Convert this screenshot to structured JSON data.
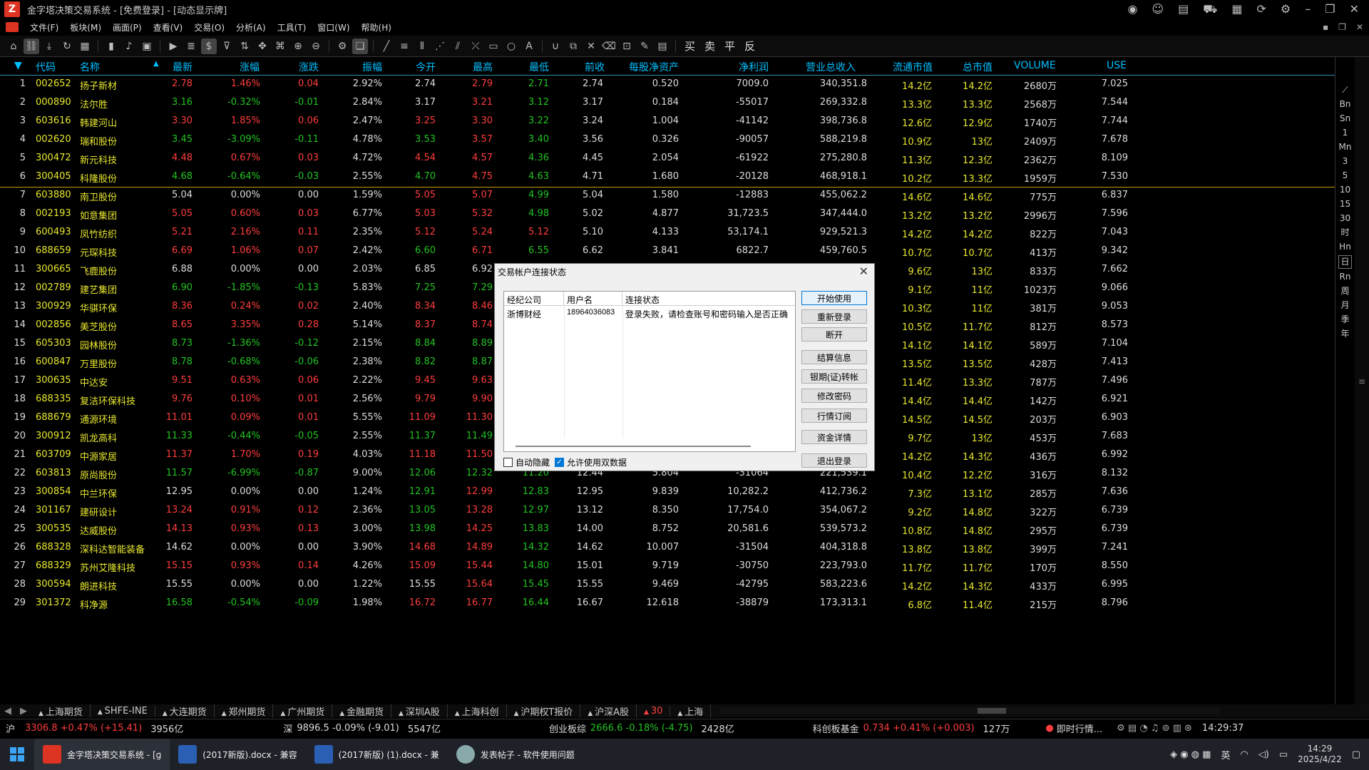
{
  "window": {
    "title": "金字塔决策交易系统 - [免费登录] - [动态显示牌]"
  },
  "menu": {
    "items": [
      "文件(F)",
      "板块(M)",
      "画面(P)",
      "查看(V)",
      "交易(O)",
      "分析(A)",
      "工具(T)",
      "窗口(W)",
      "帮助(H)"
    ]
  },
  "toolbar": {
    "trade_labels": [
      "买",
      "卖",
      "平",
      "反"
    ]
  },
  "table": {
    "headers": [
      "代码",
      "名称",
      "最新",
      "涨幅",
      "涨跌",
      "振幅",
      "今开",
      "最高",
      "最低",
      "前收",
      "每股净资产",
      "净利润",
      "营业总收入",
      "流通市值",
      "总市值",
      "VOLUME",
      "USE"
    ],
    "rows": [
      {
        "no": "1",
        "code": "002652",
        "name": "扬子新材",
        "last": "2.78",
        "pct": "1.46%",
        "chg": "0.04",
        "amp": "2.92%",
        "open": "2.74",
        "high": "2.79",
        "low": "2.71",
        "prev": "2.74",
        "nav": "0.520",
        "np": "7009.0",
        "rev": "340,351.8",
        "fmv": "14.2亿",
        "tmv": "14.2亿",
        "vol": "2680万",
        "use": "7.025"
      },
      {
        "no": "2",
        "code": "000890",
        "name": "法尔胜",
        "last": "3.16",
        "pct": "-0.32%",
        "chg": "-0.01",
        "amp": "2.84%",
        "open": "3.17",
        "high": "3.21",
        "low": "3.12",
        "prev": "3.17",
        "nav": "0.184",
        "np": "-55017",
        "rev": "269,332.8",
        "fmv": "13.3亿",
        "tmv": "13.3亿",
        "vol": "2568万",
        "use": "7.544"
      },
      {
        "no": "3",
        "code": "603616",
        "name": "韩建河山",
        "last": "3.30",
        "pct": "1.85%",
        "chg": "0.06",
        "amp": "2.47%",
        "open": "3.25",
        "high": "3.30",
        "low": "3.22",
        "prev": "3.24",
        "nav": "1.004",
        "np": "-41142",
        "rev": "398,736.8",
        "fmv": "12.6亿",
        "tmv": "12.9亿",
        "vol": "1740万",
        "use": "7.744"
      },
      {
        "no": "4",
        "code": "002620",
        "name": "瑞和股份",
        "last": "3.45",
        "pct": "-3.09%",
        "chg": "-0.11",
        "amp": "4.78%",
        "open": "3.53",
        "high": "3.57",
        "low": "3.40",
        "prev": "3.56",
        "nav": "0.326",
        "np": "-90057",
        "rev": "588,219.8",
        "fmv": "10.9亿",
        "tmv": "13亿",
        "vol": "2409万",
        "use": "7.678"
      },
      {
        "no": "5",
        "code": "300472",
        "name": "新元科技",
        "last": "4.48",
        "pct": "0.67%",
        "chg": "0.03",
        "amp": "4.72%",
        "open": "4.54",
        "high": "4.57",
        "low": "4.36",
        "prev": "4.45",
        "nav": "2.054",
        "np": "-61922",
        "rev": "275,280.8",
        "fmv": "11.3亿",
        "tmv": "12.3亿",
        "vol": "2362万",
        "use": "8.109"
      },
      {
        "no": "6",
        "code": "300405",
        "name": "科隆股份",
        "last": "4.68",
        "pct": "-0.64%",
        "chg": "-0.03",
        "amp": "2.55%",
        "open": "4.70",
        "high": "4.75",
        "low": "4.63",
        "prev": "4.71",
        "nav": "1.680",
        "np": "-20128",
        "rev": "468,918.1",
        "fmv": "10.2亿",
        "tmv": "13.3亿",
        "vol": "1959万",
        "use": "7.530"
      },
      {
        "no": "7",
        "code": "603880",
        "name": "南卫股份",
        "last": "5.04",
        "pct": "0.00%",
        "chg": "0.00",
        "amp": "1.59%",
        "open": "5.05",
        "high": "5.07",
        "low": "4.99",
        "prev": "5.04",
        "nav": "1.580",
        "np": "-12883",
        "rev": "455,062.2",
        "fmv": "14.6亿",
        "tmv": "14.6亿",
        "vol": "775万",
        "use": "6.837"
      },
      {
        "no": "8",
        "code": "002193",
        "name": "如意集团",
        "last": "5.05",
        "pct": "0.60%",
        "chg": "0.03",
        "amp": "6.77%",
        "open": "5.03",
        "high": "5.32",
        "low": "4.98",
        "prev": "5.02",
        "nav": "4.877",
        "np": "31,723.5",
        "rev": "347,444.0",
        "fmv": "13.2亿",
        "tmv": "13.2亿",
        "vol": "2996万",
        "use": "7.596"
      },
      {
        "no": "9",
        "code": "600493",
        "name": "凤竹纺织",
        "last": "5.21",
        "pct": "2.16%",
        "chg": "0.11",
        "amp": "2.35%",
        "open": "5.12",
        "high": "5.24",
        "low": "5.12",
        "prev": "5.10",
        "nav": "4.133",
        "np": "53,174.1",
        "rev": "929,521.3",
        "fmv": "14.2亿",
        "tmv": "14.2亿",
        "vol": "822万",
        "use": "7.043"
      },
      {
        "no": "10",
        "code": "688659",
        "name": "元琛科技",
        "last": "6.69",
        "pct": "1.06%",
        "chg": "0.07",
        "amp": "2.42%",
        "open": "6.60",
        "high": "6.71",
        "low": "6.55",
        "prev": "6.62",
        "nav": "3.841",
        "np": "6822.7",
        "rev": "459,760.5",
        "fmv": "10.7亿",
        "tmv": "10.7亿",
        "vol": "413万",
        "use": "9.342"
      },
      {
        "no": "11",
        "code": "300665",
        "name": "飞鹿股份",
        "last": "6.88",
        "pct": "0.00%",
        "chg": "0.00",
        "amp": "2.03%",
        "open": "6.85",
        "high": "6.92",
        "low": "",
        "prev": "",
        "nav": "",
        "np": "",
        "rev": "",
        "fmv": "9.6亿",
        "tmv": "13亿",
        "vol": "833万",
        "use": "7.662"
      },
      {
        "no": "12",
        "code": "002789",
        "name": "建艺集团",
        "last": "6.90",
        "pct": "-1.85%",
        "chg": "-0.13",
        "amp": "5.83%",
        "open": "7.25",
        "high": "7.29",
        "low": "",
        "prev": "",
        "nav": "",
        "np": "",
        "rev": "",
        "fmv": "9.1亿",
        "tmv": "11亿",
        "vol": "1023万",
        "use": "9.066"
      },
      {
        "no": "13",
        "code": "300929",
        "name": "华骐环保",
        "last": "8.36",
        "pct": "0.24%",
        "chg": "0.02",
        "amp": "2.40%",
        "open": "8.34",
        "high": "8.46",
        "low": "",
        "prev": "",
        "nav": "",
        "np": "",
        "rev": "",
        "fmv": "10.3亿",
        "tmv": "11亿",
        "vol": "381万",
        "use": "9.053"
      },
      {
        "no": "14",
        "code": "002856",
        "name": "美芝股份",
        "last": "8.65",
        "pct": "3.35%",
        "chg": "0.28",
        "amp": "5.14%",
        "open": "8.37",
        "high": "8.74",
        "low": "",
        "prev": "",
        "nav": "",
        "np": "",
        "rev": "",
        "fmv": "10.5亿",
        "tmv": "11.7亿",
        "vol": "812万",
        "use": "8.573"
      },
      {
        "no": "15",
        "code": "605303",
        "name": "园林股份",
        "last": "8.73",
        "pct": "-1.36%",
        "chg": "-0.12",
        "amp": "2.15%",
        "open": "8.84",
        "high": "8.89",
        "low": "",
        "prev": "",
        "nav": "",
        "np": "",
        "rev": "",
        "fmv": "14.1亿",
        "tmv": "14.1亿",
        "vol": "589万",
        "use": "7.104"
      },
      {
        "no": "16",
        "code": "600847",
        "name": "万里股份",
        "last": "8.78",
        "pct": "-0.68%",
        "chg": "-0.06",
        "amp": "2.38%",
        "open": "8.82",
        "high": "8.87",
        "low": "",
        "prev": "",
        "nav": "",
        "np": "",
        "rev": "",
        "fmv": "13.5亿",
        "tmv": "13.5亿",
        "vol": "428万",
        "use": "7.413"
      },
      {
        "no": "17",
        "code": "300635",
        "name": "中达安",
        "last": "9.51",
        "pct": "0.63%",
        "chg": "0.06",
        "amp": "2.22%",
        "open": "9.45",
        "high": "9.63",
        "low": "",
        "prev": "",
        "nav": "",
        "np": "",
        "rev": "",
        "fmv": "11.4亿",
        "tmv": "13.3亿",
        "vol": "787万",
        "use": "7.496"
      },
      {
        "no": "18",
        "code": "688335",
        "name": "复洁环保科技",
        "last": "9.76",
        "pct": "0.10%",
        "chg": "0.01",
        "amp": "2.56%",
        "open": "9.79",
        "high": "9.90",
        "low": "",
        "prev": "",
        "nav": "",
        "np": "",
        "rev": "",
        "fmv": "14.4亿",
        "tmv": "14.4亿",
        "vol": "142万",
        "use": "6.921"
      },
      {
        "no": "19",
        "code": "688679",
        "name": "通源环境",
        "last": "11.01",
        "pct": "0.09%",
        "chg": "0.01",
        "amp": "5.55%",
        "open": "11.09",
        "high": "11.30",
        "low": "",
        "prev": "",
        "nav": "",
        "np": "",
        "rev": "",
        "fmv": "14.5亿",
        "tmv": "14.5亿",
        "vol": "203万",
        "use": "6.903"
      },
      {
        "no": "20",
        "code": "300912",
        "name": "凯龙高科",
        "last": "11.33",
        "pct": "-0.44%",
        "chg": "-0.05",
        "amp": "2.55%",
        "open": "11.37",
        "high": "11.49",
        "low": "",
        "prev": "",
        "nav": "",
        "np": "",
        "rev": "",
        "fmv": "9.7亿",
        "tmv": "13亿",
        "vol": "453万",
        "use": "7.683"
      },
      {
        "no": "21",
        "code": "603709",
        "name": "中源家居",
        "last": "11.37",
        "pct": "1.70%",
        "chg": "0.19",
        "amp": "4.03%",
        "open": "11.18",
        "high": "11.50",
        "low": "",
        "prev": "",
        "nav": "",
        "np": "",
        "rev": "",
        "fmv": "14.2亿",
        "tmv": "14.3亿",
        "vol": "436万",
        "use": "6.992"
      },
      {
        "no": "22",
        "code": "603813",
        "name": "原尚股份",
        "last": "11.57",
        "pct": "-6.99%",
        "chg": "-0.87",
        "amp": "9.00%",
        "open": "12.06",
        "high": "12.32",
        "low": "11.20",
        "prev": "12.44",
        "nav": "5.804",
        "np": "-31064",
        "rev": "221,539.1",
        "fmv": "10.4亿",
        "tmv": "12.2亿",
        "vol": "316万",
        "use": "8.132"
      },
      {
        "no": "23",
        "code": "300854",
        "name": "中兰环保",
        "last": "12.95",
        "pct": "0.00%",
        "chg": "0.00",
        "amp": "1.24%",
        "open": "12.91",
        "high": "12.99",
        "low": "12.83",
        "prev": "12.95",
        "nav": "9.839",
        "np": "10,282.2",
        "rev": "412,736.2",
        "fmv": "7.3亿",
        "tmv": "13.1亿",
        "vol": "285万",
        "use": "7.636"
      },
      {
        "no": "24",
        "code": "301167",
        "name": "建研设计",
        "last": "13.24",
        "pct": "0.91%",
        "chg": "0.12",
        "amp": "2.36%",
        "open": "13.05",
        "high": "13.28",
        "low": "12.97",
        "prev": "13.12",
        "nav": "8.350",
        "np": "17,754.0",
        "rev": "354,067.2",
        "fmv": "9.2亿",
        "tmv": "14.8亿",
        "vol": "322万",
        "use": "6.739"
      },
      {
        "no": "25",
        "code": "300535",
        "name": "达威股份",
        "last": "14.13",
        "pct": "0.93%",
        "chg": "0.13",
        "amp": "3.00%",
        "open": "13.98",
        "high": "14.25",
        "low": "13.83",
        "prev": "14.00",
        "nav": "8.752",
        "np": "20,581.6",
        "rev": "539,573.2",
        "fmv": "10.8亿",
        "tmv": "14.8亿",
        "vol": "295万",
        "use": "6.739"
      },
      {
        "no": "26",
        "code": "688328",
        "name": "深科达智能装备",
        "last": "14.62",
        "pct": "0.00%",
        "chg": "0.00",
        "amp": "3.90%",
        "open": "14.68",
        "high": "14.89",
        "low": "14.32",
        "prev": "14.62",
        "nav": "10.007",
        "np": "-31504",
        "rev": "404,318.8",
        "fmv": "13.8亿",
        "tmv": "13.8亿",
        "vol": "399万",
        "use": "7.241"
      },
      {
        "no": "27",
        "code": "688329",
        "name": "苏州艾隆科技",
        "last": "15.15",
        "pct": "0.93%",
        "chg": "0.14",
        "amp": "4.26%",
        "open": "15.09",
        "high": "15.44",
        "low": "14.80",
        "prev": "15.01",
        "nav": "9.719",
        "np": "-30750",
        "rev": "223,793.0",
        "fmv": "11.7亿",
        "tmv": "11.7亿",
        "vol": "170万",
        "use": "8.550"
      },
      {
        "no": "28",
        "code": "300594",
        "name": "朗进科技",
        "last": "15.55",
        "pct": "0.00%",
        "chg": "0.00",
        "amp": "1.22%",
        "open": "15.55",
        "high": "15.64",
        "low": "15.45",
        "prev": "15.55",
        "nav": "9.469",
        "np": "-42795",
        "rev": "583,223.6",
        "fmv": "14.2亿",
        "tmv": "14.3亿",
        "vol": "433万",
        "use": "6.995"
      },
      {
        "no": "29",
        "code": "301372",
        "name": "科净源",
        "last": "16.58",
        "pct": "-0.54%",
        "chg": "-0.09",
        "amp": "1.98%",
        "open": "16.72",
        "high": "16.77",
        "low": "16.44",
        "prev": "16.67",
        "nav": "12.618",
        "np": "-38879",
        "rev": "173,313.1",
        "fmv": "6.8亿",
        "tmv": "11.4亿",
        "vol": "215万",
        "use": "8.796"
      }
    ]
  },
  "right_sidebar": {
    "items": [
      "Bn",
      "Sn",
      "1",
      "Mn",
      "3",
      "5",
      "10",
      "15",
      "30",
      "时",
      "Hn",
      "日",
      "Rn",
      "周",
      "月",
      "季",
      "年"
    ],
    "selected": "日"
  },
  "bottom_tabs": {
    "items": [
      "上海期货",
      "SHFE-INE",
      "大连期货",
      "郑州期货",
      "广州期货",
      "金融期货",
      "深圳A股",
      "上海科创",
      "沪期权T报价",
      "沪深A股",
      "30",
      "上海"
    ],
    "active": "30"
  },
  "status": {
    "sh_label": "沪",
    "sh_value": "3306.8 +0.47% (+15.41)",
    "sh_amount": "3956亿",
    "sz_label": "深",
    "sz_value": "9896.5 -0.09% (-9.01)",
    "sz_amount": "5547亿",
    "cyb_label": "创业板综",
    "cyb_value": "2666.6 -0.18% (-4.75)",
    "cyb_amount": "2428亿",
    "kcb_label": "科创板基金",
    "kcb_value": "0.734 +0.41% (+0.003)",
    "kcb_amount": "127万",
    "realtime_label": "即时行情...",
    "time": "14:29:37"
  },
  "dialog": {
    "title": "交易帐户连接状态",
    "columns": [
      "经纪公司",
      "用户名",
      "连接状态"
    ],
    "row": {
      "broker": "浙博财经",
      "user": "18964036083",
      "status": "登录失败，请检查账号和密码输入是否正确"
    },
    "buttons": [
      "开始使用",
      "重新登录",
      "断开",
      "结算信息",
      "银期(证)转帐",
      "修改密码",
      "行情订阅",
      "资金详情",
      "退出登录"
    ],
    "auto_hide": "自动隐藏",
    "allow_dual": "允许使用双数据"
  },
  "taskbar": {
    "apps": [
      "金字塔决策交易系统 - [ɡ",
      "(2017新版).docx - 兼容",
      "(2017新版) (1).docx - 兼",
      "发表帖子 - 软件使用问题"
    ],
    "ime": "英",
    "time": "14:29",
    "date": "2025/4/22"
  },
  "colors": {
    "up": "#ff3d3d",
    "down": "#22c322",
    "flat": "#dddddd",
    "accent": "#00bfff",
    "yellow": "#e8e830"
  }
}
